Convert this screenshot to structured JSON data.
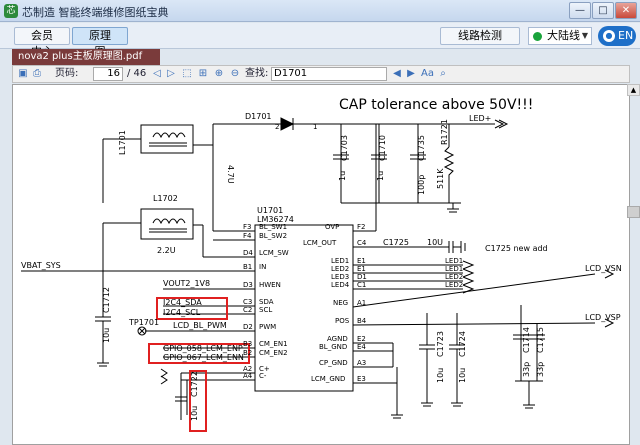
{
  "window": {
    "title": "芯制造 智能终端维修图纸宝典",
    "minimize": "—",
    "maximize": "□",
    "close": "✕"
  },
  "nav": {
    "member_center": "会员中心",
    "schematic": "原理图",
    "line_detect": "线路检测",
    "region": "大陆线",
    "lang": "EN"
  },
  "doc": {
    "tab": "nova2 plus主板原理图.pdf"
  },
  "toolbar": {
    "page_label": "页码:",
    "page_current": "16",
    "page_total": "/ 46",
    "find_label": "查找:",
    "find_value": "D1701"
  },
  "schematic": {
    "title_note": "CAP tolerance above 50V!!!",
    "d1701": "D1701",
    "d1701_pin2": "2",
    "d1701_pin1": "1",
    "led_plus": "LED+",
    "l1701": "L1701",
    "l1701_val": "4.7U",
    "l1702": "L1702",
    "l1702_val": "2.2U",
    "c1703": "C1703",
    "c1703_val": "1u",
    "c1710": "C1710",
    "c1710_val": "1u",
    "c1735": "C1735",
    "c1735_val": "100p",
    "r1721": "R1721",
    "r1721_val": "511K",
    "u1701": "U1701",
    "u1701_part": "LM36274",
    "vbat_sys": "VBAT_SYS",
    "c1712": "C1712",
    "c1712_val": "10u",
    "vout2": "VOUT2_1V8",
    "i2c4_sda": "I2C4_SDA",
    "i2c4_scl": "I2C4_SCL",
    "tp1701": "TP1701",
    "lcd_bl_pwm": "LCD_BL_PWM",
    "gpio058": "GPIO_058_LCM_ENP",
    "gpio067": "GPIO_067_LCM_ENN",
    "c1722": "C1722",
    "c1722_val": "10u",
    "c1725": "C1725",
    "c1725_val": "10U",
    "c1725_note": "C1725 new add",
    "lcd_vsn": "LCD_VSN",
    "lcd_vsp": "LCD_VSP",
    "c1723": "C1723",
    "c1723_val": "10u",
    "c1724": "C1724",
    "c1724_val": "10u",
    "c1714": "C1714",
    "c1714_val": "33p",
    "c1715": "C1715",
    "c1715_val": "33p",
    "led1": "LED1",
    "led2": "LED2",
    "pins_left": [
      {
        "pin": "F3",
        "name": "BL_SW1"
      },
      {
        "pin": "F4",
        "name": "BL_SW2"
      },
      {
        "pin": "D4",
        "name": "LCM_SW"
      },
      {
        "pin": "B1",
        "name": "IN"
      },
      {
        "pin": "D3",
        "name": "HWEN"
      },
      {
        "pin": "C3",
        "name": "SDA"
      },
      {
        "pin": "C2",
        "name": "SCL"
      },
      {
        "pin": "D2",
        "name": "PWM"
      },
      {
        "pin": "B3",
        "name": "CM_EN1"
      },
      {
        "pin": "B2",
        "name": "CM_EN2"
      },
      {
        "pin": "A2",
        "name": "C+"
      },
      {
        "pin": "A4",
        "name": "C-"
      }
    ],
    "pins_right": [
      {
        "pin": "F2",
        "name": "OVP"
      },
      {
        "pin": "C4",
        "name": "LCM_OUT"
      },
      {
        "pin": "E1",
        "name": "LED1"
      },
      {
        "pin": "E1",
        "name": "LED2"
      },
      {
        "pin": "D1",
        "name": "LED3"
      },
      {
        "pin": "C1",
        "name": "LED4"
      },
      {
        "pin": "A1",
        "name": "NEG"
      },
      {
        "pin": "B4",
        "name": "POS"
      },
      {
        "pin": "E2",
        "name": "AGND"
      },
      {
        "pin": "E4",
        "name": "BL_GND"
      },
      {
        "pin": "A3",
        "name": "CP_GND"
      },
      {
        "pin": "E3",
        "name": "LCM_GND"
      }
    ],
    "led_flags": [
      "LED1",
      "LED1",
      "LED2",
      "LED2"
    ]
  }
}
